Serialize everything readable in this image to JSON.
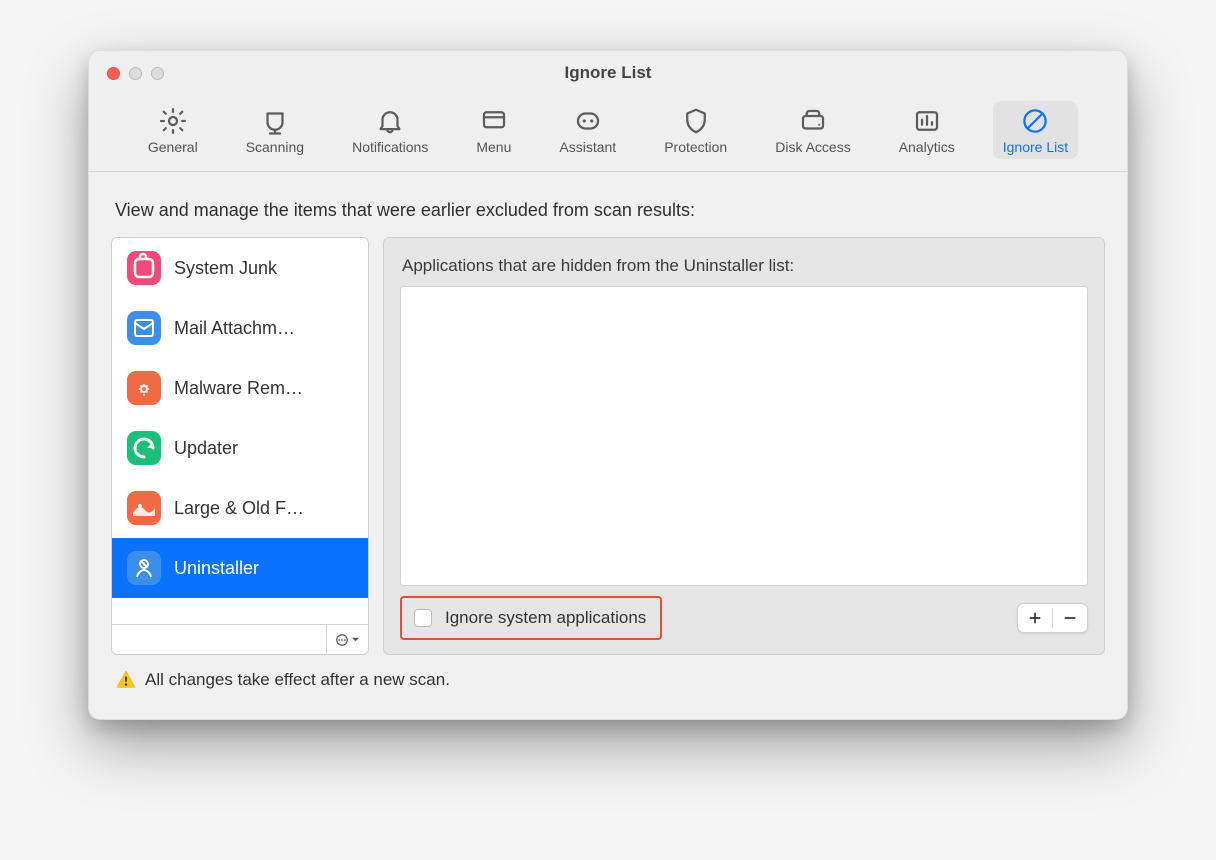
{
  "window": {
    "title": "Ignore List"
  },
  "toolbar": [
    {
      "label": "General",
      "icon": "gear",
      "active": false
    },
    {
      "label": "Scanning",
      "icon": "scan",
      "active": false
    },
    {
      "label": "Notifications",
      "icon": "bell",
      "active": false
    },
    {
      "label": "Menu",
      "icon": "menu",
      "active": false
    },
    {
      "label": "Assistant",
      "icon": "assistant",
      "active": false
    },
    {
      "label": "Protection",
      "icon": "shield",
      "active": false
    },
    {
      "label": "Disk Access",
      "icon": "disk",
      "active": false
    },
    {
      "label": "Analytics",
      "icon": "chart",
      "active": false
    },
    {
      "label": "Ignore List",
      "icon": "ban",
      "active": true
    }
  ],
  "intro": "View and manage the items that were earlier excluded from scan results:",
  "sidebar": [
    {
      "label": "System Junk",
      "color": "#ef4a7a",
      "selected": false
    },
    {
      "label": "Mail Attachm…",
      "color": "#3b8fe8",
      "selected": false
    },
    {
      "label": "Malware Rem…",
      "color": "#f06a44",
      "selected": false
    },
    {
      "label": "Updater",
      "color": "#1bbf7b",
      "selected": false
    },
    {
      "label": "Large & Old F…",
      "color": "#f06a44",
      "selected": false
    },
    {
      "label": "Uninstaller",
      "color": "#3b8fe8",
      "selected": true
    }
  ],
  "search_value": "",
  "main": {
    "heading": "Applications that are hidden from the Uninstaller list:",
    "checkbox_label": "Ignore system applications",
    "checkbox_checked": false
  },
  "footer_note": "All changes take effect after a new scan."
}
